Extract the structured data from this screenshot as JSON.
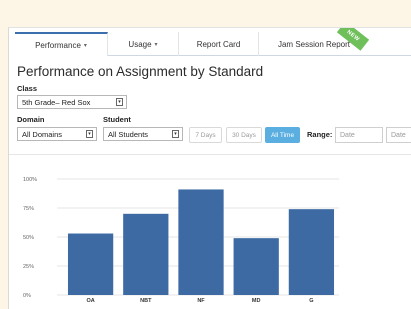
{
  "tabs": [
    {
      "label": "Performance",
      "caret": "▾",
      "active": true
    },
    {
      "label": "Usage",
      "caret": "▾",
      "active": false
    },
    {
      "label": "Report Card",
      "caret": "",
      "active": false
    },
    {
      "label": "Jam Session Report",
      "caret": "",
      "active": false
    }
  ],
  "new_badge": "NEW",
  "page_title": "Performance on Assignment by Standard",
  "class_filter": {
    "label": "Class",
    "value": "5th Grade– Red Sox"
  },
  "domain_filter": {
    "label": "Domain",
    "value": "All Domains"
  },
  "student_filter": {
    "label": "Student",
    "value": "All Students"
  },
  "time_buttons": [
    {
      "label": "7 Days",
      "selected": false
    },
    {
      "label": "30 Days",
      "selected": false
    },
    {
      "label": "All Time",
      "selected": true
    }
  ],
  "range": {
    "label": "Range:",
    "start_placeholder": "Date",
    "end_placeholder": "Date"
  },
  "colors": {
    "accent": "#3c6fae",
    "bar": "#3e6aa3",
    "selected_button": "#5aaee0",
    "new_badge": "#6fbf5a"
  },
  "chart_data": {
    "type": "bar",
    "categories": [
      "OA",
      "NBT",
      "NF",
      "MD",
      "G"
    ],
    "values": [
      53,
      70,
      91,
      49,
      74
    ],
    "ylim": [
      0,
      100
    ],
    "yticks": [
      "0%",
      "25%",
      "50%",
      "75%",
      "100%"
    ],
    "grid": true
  }
}
